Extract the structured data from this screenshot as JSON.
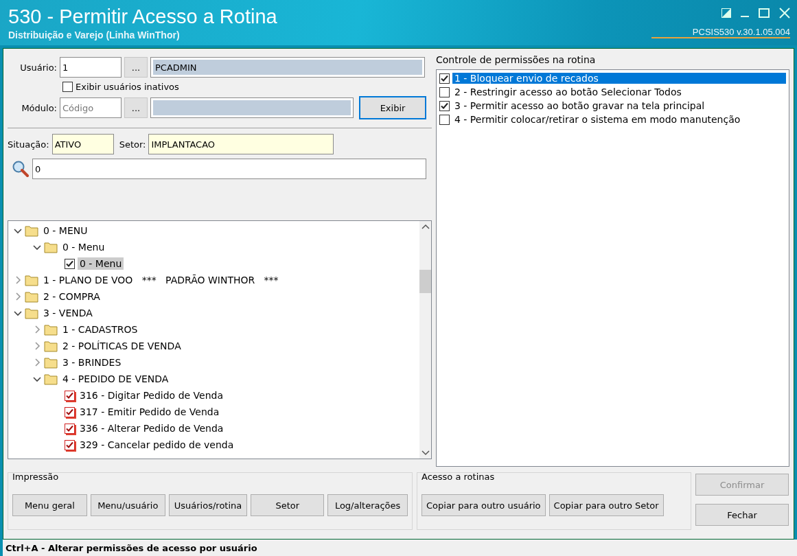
{
  "window": {
    "title": "530 - Permitir Acesso a Rotina",
    "subtitle": "Distribuição e Varejo (Linha WinThor)",
    "version": "PCSIS530  v.30.1.05.004"
  },
  "user": {
    "label": "Usuário:",
    "code": "1",
    "browse": "...",
    "name": "PCADMIN"
  },
  "show_inactive": {
    "label": "Exibir usuários inativos",
    "checked": false
  },
  "module": {
    "label": "Módulo:",
    "placeholder": "Código",
    "browse": "...",
    "show_button": "Exibir"
  },
  "status": {
    "situation_label": "Situação:",
    "situation": "ATIVO",
    "sector_label": "Setor:",
    "sector": "IMPLANTACAO"
  },
  "search": {
    "value": "0"
  },
  "tree": [
    {
      "kind": "folder",
      "label": "0 - MENU",
      "expanded": true,
      "children": [
        {
          "kind": "folder",
          "label": "0 - Menu",
          "expanded": true,
          "children": [
            {
              "kind": "check",
              "label": "0 - Menu",
              "checked": true,
              "changed": false,
              "selected": true
            }
          ]
        }
      ]
    },
    {
      "kind": "folder",
      "label": "1 - PLANO DE VOO   ***   PADRÃO WINTHOR   ***",
      "expanded": false
    },
    {
      "kind": "folder",
      "label": "2 - COMPRA",
      "expanded": false
    },
    {
      "kind": "folder",
      "label": "3 - VENDA",
      "expanded": true,
      "children": [
        {
          "kind": "folder",
          "label": "1 - CADASTROS",
          "expanded": false
        },
        {
          "kind": "folder",
          "label": "2 - POLÍTICAS DE VENDA",
          "expanded": false
        },
        {
          "kind": "folder",
          "label": "3 - BRINDES",
          "expanded": false
        },
        {
          "kind": "folder",
          "label": "4 - PEDIDO DE VENDA",
          "expanded": true,
          "children": [
            {
              "kind": "check",
              "label": "316 - Digitar Pedido de Venda",
              "checked": true,
              "changed": true,
              "selected": false
            },
            {
              "kind": "check",
              "label": "317 - Emitir Pedido de Venda",
              "checked": true,
              "changed": true,
              "selected": false
            },
            {
              "kind": "check",
              "label": "336 - Alterar Pedido de Venda",
              "checked": true,
              "changed": true,
              "selected": false
            },
            {
              "kind": "check",
              "label": "329 - Cancelar pedido de venda",
              "checked": true,
              "changed": true,
              "selected": false
            }
          ]
        }
      ]
    }
  ],
  "permissions": {
    "title": "Controle de permissões na rotina",
    "items": [
      {
        "label": "1 - Bloquear envio de recados",
        "checked": true,
        "selected": true
      },
      {
        "label": "2 - Restringir acesso ao botão Selecionar Todos",
        "checked": false,
        "selected": false
      },
      {
        "label": "3 - Permitir acesso ao botão gravar na tela principal",
        "checked": true,
        "selected": false
      },
      {
        "label": "4 - Permitir colocar/retirar o sistema em modo manutenção",
        "checked": false,
        "selected": false
      }
    ]
  },
  "printing": {
    "title": "Impressão",
    "buttons": [
      "Menu geral",
      "Menu/usuário",
      "Usuários/rotina",
      "Setor",
      "Log/alterações"
    ]
  },
  "access": {
    "title": "Acesso a rotinas",
    "buttons": [
      "Copiar para outro usuário",
      "Copiar para outro Setor"
    ]
  },
  "actions": [
    {
      "label": "Confirmar",
      "disabled": true
    },
    {
      "label": "Fechar",
      "disabled": false
    }
  ],
  "status_bar": "Ctrl+A - Alterar permissões de acesso por usuário"
}
